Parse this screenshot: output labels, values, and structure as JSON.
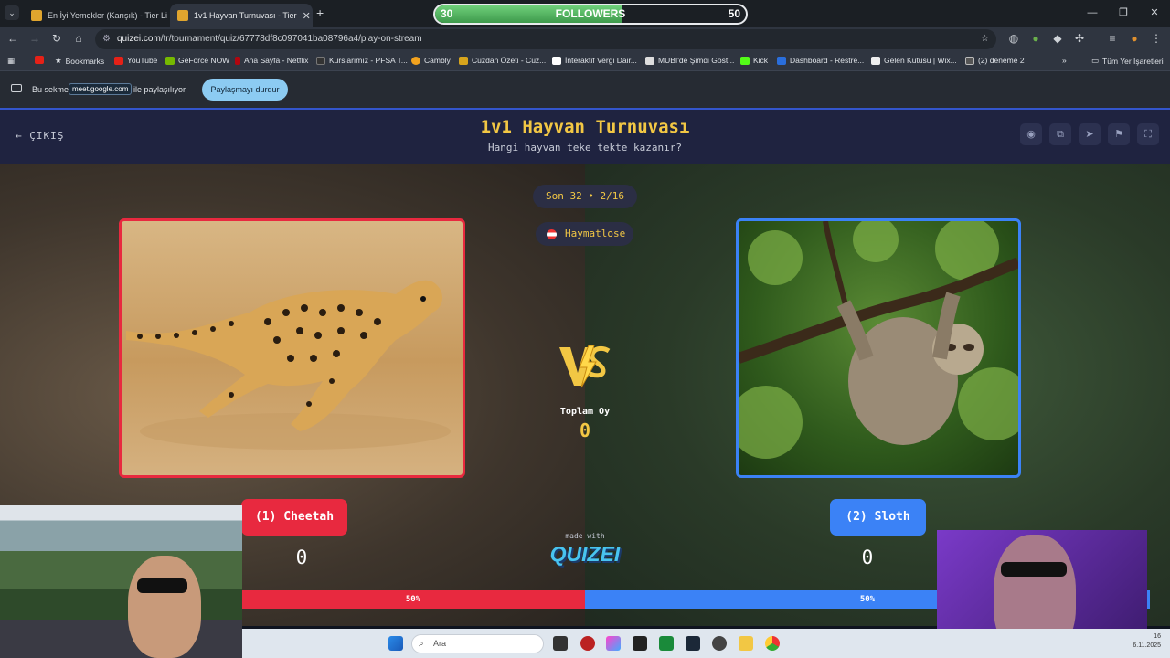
{
  "browser": {
    "tabs": [
      {
        "title": "En İyi Yemekler (Karışık) - Tier Li",
        "active": false
      },
      {
        "title": "1v1 Hayvan Turnuvası - Tier",
        "active": true
      }
    ],
    "url_host": "quizei.com",
    "url_path": "/tr/tournament/quiz/67778df8c097041ba08796a4/play-on-stream",
    "bookmarks": [
      "Bookmarks",
      "YouTube",
      "GeForce NOW",
      "Ana Sayfa - Netflix",
      "Kurslarımız - PFSA T...",
      "Cambly",
      "Cüzdan Özeti - Cüz...",
      "İnteraktif Vergi Dair...",
      "MUBI'de Şimdi Göst...",
      "Kick",
      "Dashboard - Restre...",
      "Gelen Kutusu | Wix...",
      "(2) deneme 2"
    ],
    "all_bookmarks": "Tüm Yer İşaretleri",
    "share_bar": {
      "prefix": "Bu sekme",
      "host": "meet.google.com",
      "suffix": "ile paylaşılıyor",
      "stop_button": "Paylaşmayı durdur"
    }
  },
  "followers": {
    "current": "30",
    "label": "FOLLOWERS",
    "goal": "50",
    "progress": 0.6
  },
  "quiz": {
    "exit_label": "ÇIKIŞ",
    "title": "1v1 Hayvan Turnuvası",
    "subtitle": "Hangi hayvan teke tekte kazanır?",
    "round": "Son 32 • 2/16",
    "user": "Haymatlose",
    "total_votes_label": "Toplam Oy",
    "total_votes": "0",
    "made_with": "made with",
    "logo": "QUIZEI",
    "left": {
      "name": "(1) Cheetah",
      "score": "0",
      "percent": "50%",
      "color": "#e8293f"
    },
    "right": {
      "name": "(2) Sloth",
      "score": "0",
      "percent": "50%",
      "color": "#3b82f6"
    }
  },
  "taskbar": {
    "search_placeholder": "Ara",
    "time": "16",
    "date": "6.11.2025"
  }
}
